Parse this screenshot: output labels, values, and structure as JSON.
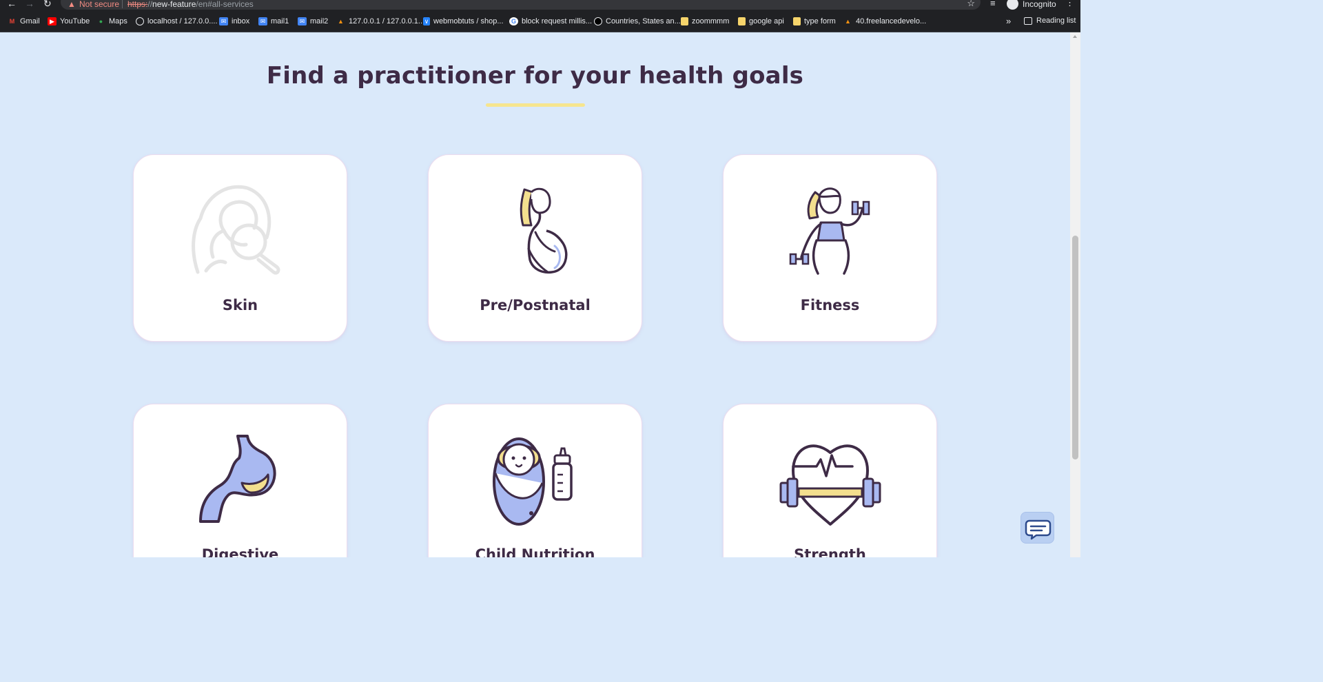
{
  "browser": {
    "security_label": "Not secure",
    "url_scheme": "https:",
    "url_slashes": "//",
    "url_host": "new-feature",
    "url_path": "/en#all-services",
    "profile_label": "Incognito",
    "reading_list_label": "Reading list"
  },
  "bookmarks": [
    {
      "label": "Gmail",
      "icon": "gmail-icon",
      "color": "#ea4335"
    },
    {
      "label": "YouTube",
      "icon": "youtube-icon",
      "color": "#ff0000"
    },
    {
      "label": "Maps",
      "icon": "maps-icon",
      "color": "#34a853"
    },
    {
      "label": "localhost / 127.0.0....",
      "icon": "globe-icon",
      "color": "#e8eaed"
    },
    {
      "label": "inbox",
      "icon": "mail-icon",
      "color": "#4285f4"
    },
    {
      "label": "mail1",
      "icon": "mail-icon",
      "color": "#4285f4"
    },
    {
      "label": "mail2",
      "icon": "mail-icon",
      "color": "#4285f4"
    },
    {
      "label": "127.0.0.1 / 127.0.0.1...",
      "icon": "phpmyadmin-icon",
      "color": "#f29111"
    },
    {
      "label": "webmobtuts / shop...",
      "icon": "bitbucket-icon",
      "color": "#2684ff"
    },
    {
      "label": "block request millis...",
      "icon": "google-icon",
      "color": "#ffffff"
    },
    {
      "label": "Countries, States an...",
      "icon": "site-icon",
      "color": "#000000"
    },
    {
      "label": "zoommmm",
      "icon": "folder-icon",
      "color": "#f6d46b"
    },
    {
      "label": "google api",
      "icon": "folder-icon",
      "color": "#f6d46b"
    },
    {
      "label": "type form",
      "icon": "folder-icon",
      "color": "#f6d46b"
    },
    {
      "label": "40.freelancedevelo...",
      "icon": "phpmyadmin-icon",
      "color": "#f29111"
    }
  ],
  "page": {
    "heading": "Find a practitioner for your health goals",
    "services": [
      {
        "label": "Skin",
        "icon": "skin-magnifier-icon"
      },
      {
        "label": "Pre/Postnatal",
        "icon": "pregnant-woman-icon"
      },
      {
        "label": "Fitness",
        "icon": "woman-dumbbells-icon"
      },
      {
        "label": "Digestive",
        "icon": "stomach-icon"
      },
      {
        "label": "Child Nutrition",
        "icon": "baby-bottle-icon"
      },
      {
        "label": "Strength",
        "icon": "heart-dumbbell-icon"
      }
    ]
  },
  "colors": {
    "background": "#dae9fa",
    "heading": "#3e2b46",
    "accent_yellow": "#f6e58e",
    "accent_blue": "#a9b9f1",
    "card": "#ffffff"
  }
}
